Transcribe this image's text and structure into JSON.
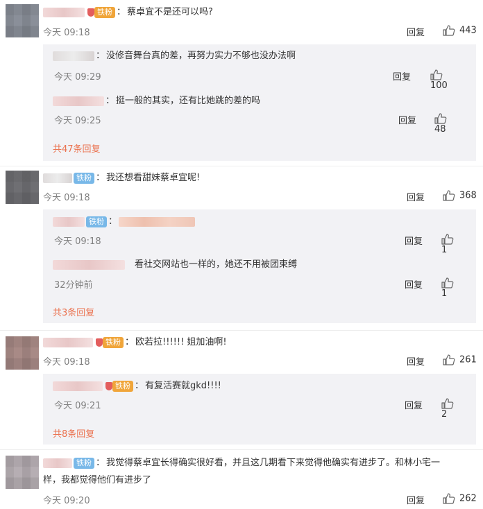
{
  "comments": [
    {
      "text": "蔡卓宜不是还可以吗?",
      "badge": "铁粉",
      "time": "今天 09:18",
      "reply_label": "回复",
      "likes": "443",
      "replies": [
        {
          "text": "没修音舞台真的差，再努力实力不够也没办法啊",
          "time": "今天 09:29",
          "reply_label": "回复",
          "likes": "100"
        },
        {
          "text": "挺一般的其实，还有比她跳的差的吗",
          "time": "今天 09:25",
          "reply_label": "回复",
          "likes": "48"
        }
      ],
      "more": "共47条回复"
    },
    {
      "text": "我还想看甜妹蔡卓宜呢!",
      "badge": "铁粉",
      "time": "今天 09:18",
      "reply_label": "回复",
      "likes": "368",
      "replies": [
        {
          "badge": "铁粉",
          "text": "",
          "time": "今天 09:18",
          "reply_label": "回复",
          "likes": "1"
        },
        {
          "text": "看社交网站也一样的，她还不用被团束缚",
          "time": "32分钟前",
          "reply_label": "回复",
          "likes": "1"
        }
      ],
      "more": "共3条回复"
    },
    {
      "text": "欧若拉!!!!!! 姐加油啊!",
      "badge": "铁粉",
      "time": "今天 09:18",
      "reply_label": "回复",
      "likes": "261",
      "replies": [
        {
          "badge": "铁粉",
          "text": "有复活赛就gkd!!!!",
          "time": "今天 09:21",
          "reply_label": "回复",
          "likes": "2"
        }
      ],
      "more": "共8条回复"
    },
    {
      "text": "我觉得蔡卓宜长得确实很好看，并且这几期看下来觉得他确实有进步了。和林小宅一",
      "text2": "样，我都觉得他们有进步了",
      "badge": "铁粉",
      "time": "今天 09:20",
      "reply_label": "回复",
      "likes": "262"
    }
  ],
  "colors": {
    "link": "#eb7350",
    "badge_orange": "#f0a53a",
    "badge_blue": "#78b8e8",
    "reply_bg": "#f2f2f5"
  }
}
